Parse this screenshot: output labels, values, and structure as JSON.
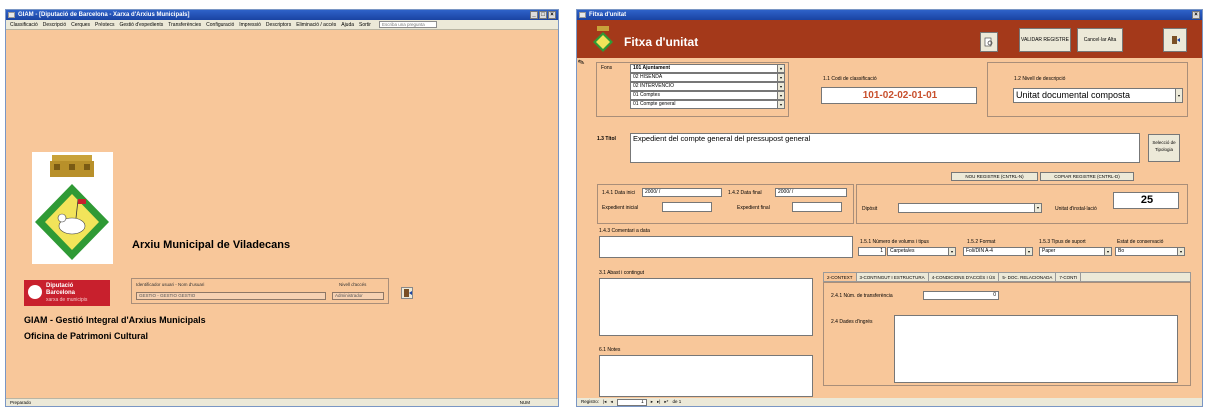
{
  "left_window": {
    "title": "GIAM - [Diputació de Barcelona - Xarxa d'Arxius Municipals]",
    "menu": [
      "Classificació",
      "Descripció",
      "Cerques",
      "Préstecs",
      "Gestió d'expedients",
      "Transferències",
      "Configuració",
      "Impressió",
      "Descriptors",
      "Eliminació / accés",
      "Ajuda",
      "Sortir"
    ],
    "search_placeholder": "Escriba una pregunta",
    "app_title": "Arxiu Municipal de Viladecans",
    "logo": {
      "line1": "Diputació",
      "line2": "Barcelona",
      "line3": "xarxa de municipis"
    },
    "user_panel": {
      "id_label": "Identificador usuari - Nom d'usuari",
      "id_value": "GESTIO - GESTIO GESTIO",
      "level_label": "Nivell d'accés",
      "level_value": "Administrador"
    },
    "footer1": "GIAM - Gestió Integral d'Arxius Municipals",
    "footer2": "Oficina de Patrimoni Cultural",
    "status": "Preparado",
    "status_right": "NUM"
  },
  "right_window": {
    "title": "Fitxa d'unitat",
    "form_title": "Fitxa d'unitat",
    "buttons": {
      "validate": "VALIDAR REGISTRE",
      "cancel": "Cancel·lar Alta"
    },
    "fons_label": "Fons",
    "hierarchy": [
      "101 Ajuntament",
      "02 HISENDA",
      "02 INTERVENCIÓ",
      "01 Comptes",
      "01 Compte general"
    ],
    "code_label": "1.1 Codi de classificació",
    "code_value": "101-02-02-01-01",
    "level_label": "1.2 Nivell de descripció",
    "level_value": "Unitat documental composta",
    "title_label": "1.3 Títol",
    "title_value": "Expedient del compte general del pressupost general",
    "tipologia_btn": "Selecció de Tipologia",
    "new_record_btn": "NOU REGISTRE (CNTRL-N)",
    "copy_record_btn": "COPIAR REGISTRE (CNTRL-D)",
    "date_start_label": "1.4.1 Data inici",
    "date_start_value": "2000/ /",
    "date_end_label": "1.4.2 Data final",
    "date_end_value": "2000/ /",
    "exp_start_label": "Expedient inicial",
    "exp_end_label": "Expedient final",
    "diposit_label": "Dipòsit",
    "unit_label": "Unitat d'instal·lació",
    "unit_value": "25",
    "date_comment_label": "1.4.3 Comentari a data",
    "volumes_label": "1.5.1 Número de volums i tipus",
    "volumes_value": "1",
    "volumes_type": "Carpeta/es",
    "format_label": "1.5.2 Format",
    "format_value": "Foli/DIN A-4",
    "support_label": "1.5.3 Tipus de suport",
    "support_value": "Paper",
    "state_label": "Estat de conservació",
    "state_value": "Bo",
    "scope_label": "3.1 Abast i contingut",
    "notes_label": "6.1 Notes",
    "tabs": [
      "2-CONTEXT",
      "3-CONTINGUT I ESTRUCTURA",
      "4-CONDICIONS D'ACCÉS I ÚS",
      "5- DOC. RELACIONADA",
      "7-CONTI"
    ],
    "transfer_label": "2.4.1 Núm. de transferència",
    "transfer_value": "0",
    "ingress_label": "2.4 Dades d'ingrés",
    "record_nav": {
      "label": "Registro:",
      "current": "1",
      "total": "de 1"
    }
  }
}
